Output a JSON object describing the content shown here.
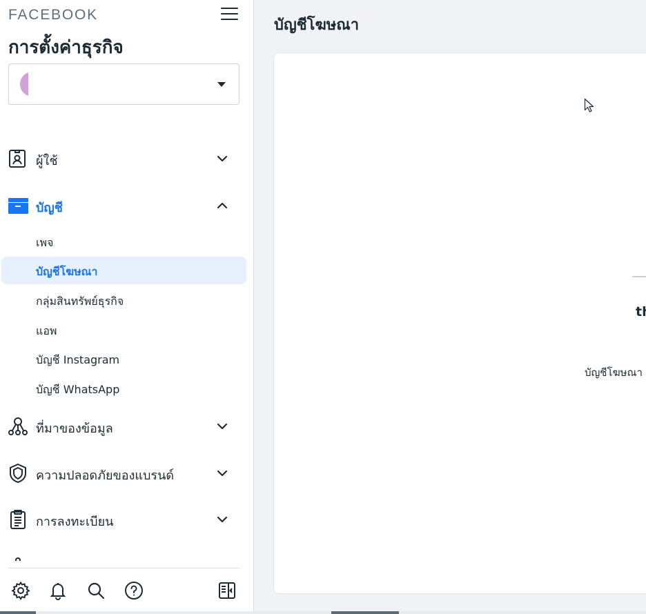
{
  "brand": "FACEBOOK",
  "page_heading": "การตั้งค่าธุรกิจ",
  "business_select": {
    "selected_value": ""
  },
  "nav": {
    "users": {
      "label": "ผู้ใช้",
      "icon": "id-badge-icon"
    },
    "accounts": {
      "label": "บัญชี",
      "icon": "folder-icon",
      "expanded": true,
      "items": [
        {
          "label": "เพจ"
        },
        {
          "label": "บัญชีโฆษณา",
          "selected": true
        },
        {
          "label": "กลุ่มสินทรัพย์ธุรกิจ"
        },
        {
          "label": "แอพ"
        },
        {
          "label": "บัญชี Instagram"
        },
        {
          "label": "บัญชี WhatsApp"
        }
      ]
    },
    "data_sources": {
      "label": "ที่มาของข้อมูล",
      "icon": "nodes-icon"
    },
    "brand_safety": {
      "label": "ความปลอดภัยของแบรนด์",
      "icon": "shield-icon"
    },
    "registrations": {
      "label": "การลงทะเบียน",
      "icon": "clipboard-icon"
    }
  },
  "bottom_icons": [
    "gear-icon",
    "bell-icon",
    "search-icon",
    "help-icon",
    "panel-toggle-icon"
  ],
  "main": {
    "title": "บัญชีโฆษณา",
    "card_heading": "th",
    "card_subtext": "บัญชีโฆษณา"
  },
  "colors": {
    "accent": "#1876f2",
    "selected_bg": "#e7f0fd",
    "text": "#1c2b33",
    "page_bg": "#f0f2f5"
  }
}
